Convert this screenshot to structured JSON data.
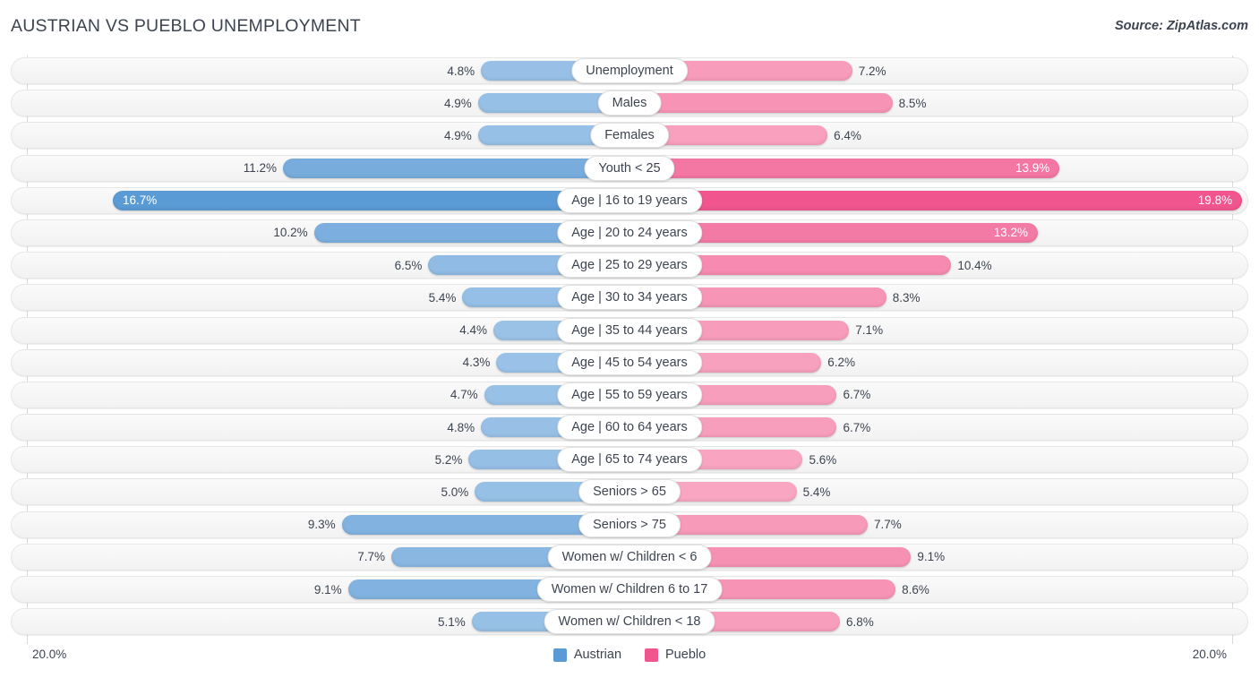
{
  "header": {
    "title": "AUSTRIAN VS PUEBLO UNEMPLOYMENT",
    "source": "Source: ZipAtlas.com"
  },
  "axis": {
    "left_max_label": "20.0%",
    "right_max_label": "20.0%",
    "max": 20.0
  },
  "legend": {
    "items": [
      {
        "label": "Austrian",
        "color": "#5B9BD5"
      },
      {
        "label": "Pueblo",
        "color": "#F0558E"
      }
    ]
  },
  "colors": {
    "austrian_light": "#9CC3E8",
    "austrian_dark": "#5B9BD5",
    "pueblo_light": "#F9A8C3",
    "pueblo_dark": "#F0558E",
    "track": "#f4f4f4",
    "text": "#3d4450"
  },
  "chart_data": {
    "type": "bar",
    "title": "AUSTRIAN VS PUEBLO UNEMPLOYMENT",
    "subtitle": "Source: ZipAtlas.com",
    "orientation": "horizontal-diverging",
    "xlabel": "",
    "ylabel": "",
    "xlim": [
      -20.0,
      20.0
    ],
    "grid": true,
    "legend_position": "bottom-center",
    "categories": [
      "Unemployment",
      "Males",
      "Females",
      "Youth < 25",
      "Age | 16 to 19 years",
      "Age | 20 to 24 years",
      "Age | 25 to 29 years",
      "Age | 30 to 34 years",
      "Age | 35 to 44 years",
      "Age | 45 to 54 years",
      "Age | 55 to 59 years",
      "Age | 60 to 64 years",
      "Age | 65 to 74 years",
      "Seniors > 65",
      "Seniors > 75",
      "Women w/ Children < 6",
      "Women w/ Children 6 to 17",
      "Women w/ Children < 18"
    ],
    "series": [
      {
        "name": "Austrian",
        "side": "left",
        "color": "#9CC3E8",
        "values": [
          4.8,
          4.9,
          4.9,
          11.2,
          16.7,
          10.2,
          6.5,
          5.4,
          4.4,
          4.3,
          4.7,
          4.8,
          5.2,
          5.0,
          9.3,
          7.7,
          9.1,
          5.1
        ],
        "labels": [
          "4.8%",
          "4.9%",
          "4.9%",
          "11.2%",
          "16.7%",
          "10.2%",
          "6.5%",
          "5.4%",
          "4.4%",
          "4.3%",
          "4.7%",
          "4.8%",
          "5.2%",
          "5.0%",
          "9.3%",
          "7.7%",
          "9.1%",
          "5.1%"
        ]
      },
      {
        "name": "Pueblo",
        "side": "right",
        "color": "#F9A8C3",
        "values": [
          7.2,
          8.5,
          6.4,
          13.9,
          19.8,
          13.2,
          10.4,
          8.3,
          7.1,
          6.2,
          6.7,
          6.7,
          5.6,
          5.4,
          7.7,
          9.1,
          8.6,
          6.8
        ],
        "labels": [
          "7.2%",
          "8.5%",
          "6.4%",
          "13.9%",
          "19.8%",
          "13.2%",
          "10.4%",
          "8.3%",
          "7.1%",
          "6.2%",
          "6.7%",
          "6.7%",
          "5.6%",
          "5.4%",
          "7.7%",
          "9.1%",
          "8.6%",
          "6.8%"
        ]
      }
    ]
  },
  "rows": [
    {
      "label": "Unemployment",
      "left": 4.8,
      "left_label": "4.8%",
      "right": 7.2,
      "right_label": "7.2%"
    },
    {
      "label": "Males",
      "left": 4.9,
      "left_label": "4.9%",
      "right": 8.5,
      "right_label": "8.5%"
    },
    {
      "label": "Females",
      "left": 4.9,
      "left_label": "4.9%",
      "right": 6.4,
      "right_label": "6.4%"
    },
    {
      "label": "Youth < 25",
      "left": 11.2,
      "left_label": "11.2%",
      "right": 13.9,
      "right_label": "13.9%"
    },
    {
      "label": "Age | 16 to 19 years",
      "left": 16.7,
      "left_label": "16.7%",
      "right": 19.8,
      "right_label": "19.8%"
    },
    {
      "label": "Age | 20 to 24 years",
      "left": 10.2,
      "left_label": "10.2%",
      "right": 13.2,
      "right_label": "13.2%"
    },
    {
      "label": "Age | 25 to 29 years",
      "left": 6.5,
      "left_label": "6.5%",
      "right": 10.4,
      "right_label": "10.4%"
    },
    {
      "label": "Age | 30 to 34 years",
      "left": 5.4,
      "left_label": "5.4%",
      "right": 8.3,
      "right_label": "8.3%"
    },
    {
      "label": "Age | 35 to 44 years",
      "left": 4.4,
      "left_label": "4.4%",
      "right": 7.1,
      "right_label": "7.1%"
    },
    {
      "label": "Age | 45 to 54 years",
      "left": 4.3,
      "left_label": "4.3%",
      "right": 6.2,
      "right_label": "6.2%"
    },
    {
      "label": "Age | 55 to 59 years",
      "left": 4.7,
      "left_label": "4.7%",
      "right": 6.7,
      "right_label": "6.7%"
    },
    {
      "label": "Age | 60 to 64 years",
      "left": 4.8,
      "left_label": "4.8%",
      "right": 6.7,
      "right_label": "6.7%"
    },
    {
      "label": "Age | 65 to 74 years",
      "left": 5.2,
      "left_label": "5.2%",
      "right": 5.6,
      "right_label": "5.6%"
    },
    {
      "label": "Seniors > 65",
      "left": 5.0,
      "left_label": "5.0%",
      "right": 5.4,
      "right_label": "5.4%"
    },
    {
      "label": "Seniors > 75",
      "left": 9.3,
      "left_label": "9.3%",
      "right": 7.7,
      "right_label": "7.7%"
    },
    {
      "label": "Women w/ Children < 6",
      "left": 7.7,
      "left_label": "7.7%",
      "right": 9.1,
      "right_label": "9.1%"
    },
    {
      "label": "Women w/ Children 6 to 17",
      "left": 9.1,
      "left_label": "9.1%",
      "right": 8.6,
      "right_label": "8.6%"
    },
    {
      "label": "Women w/ Children < 18",
      "left": 5.1,
      "left_label": "5.1%",
      "right": 6.8,
      "right_label": "6.8%"
    }
  ]
}
